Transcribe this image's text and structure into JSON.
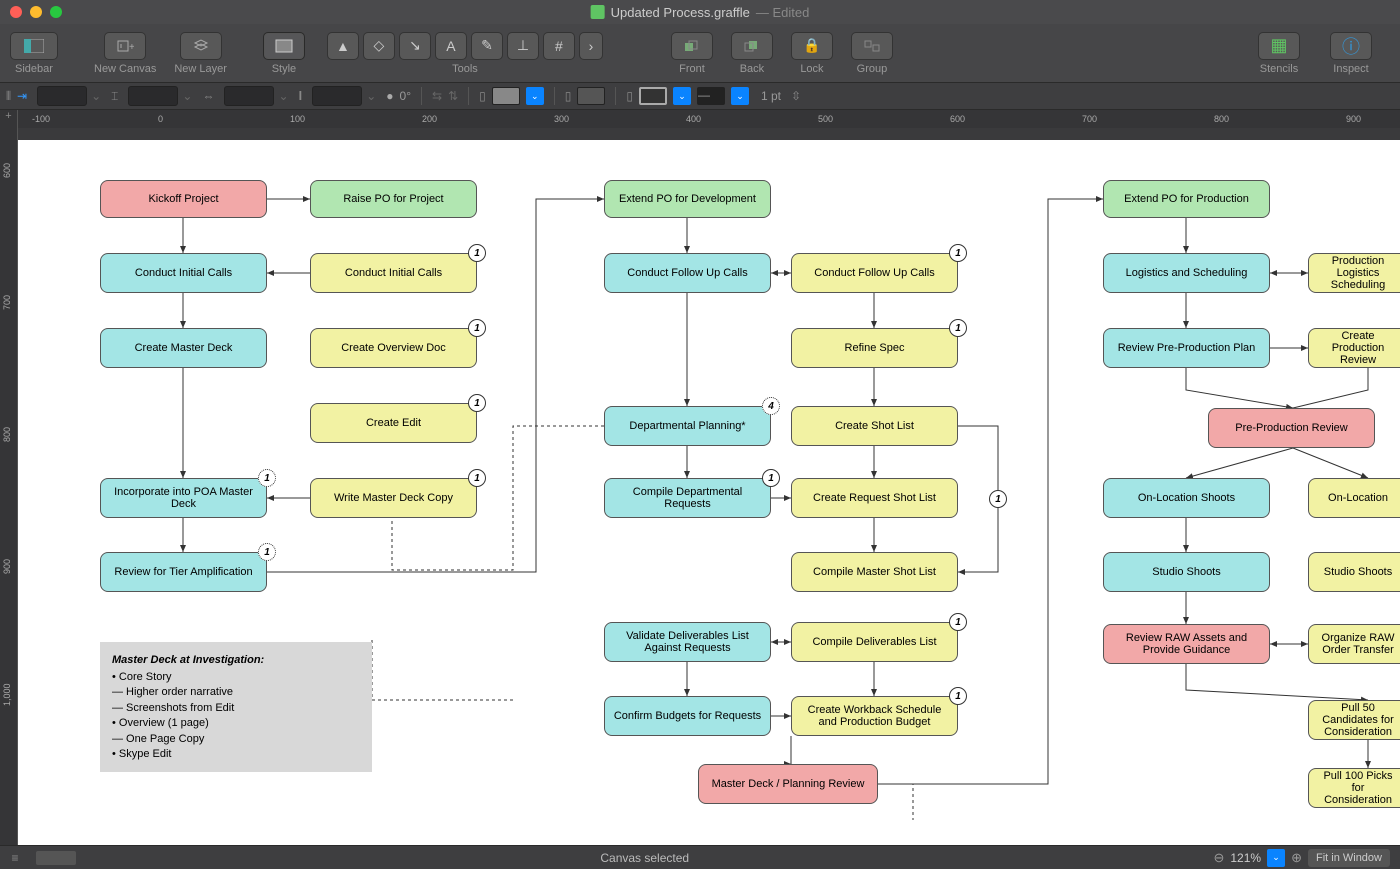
{
  "window": {
    "title": "Updated Process.graffle",
    "edited_suffix": "— Edited"
  },
  "toolbar": {
    "sidebar": "Sidebar",
    "new_canvas": "New Canvas",
    "new_layer": "New Layer",
    "style": "Style",
    "tools": "Tools",
    "front": "Front",
    "back": "Back",
    "lock": "Lock",
    "group": "Group",
    "stencils": "Stencils",
    "inspect": "Inspect"
  },
  "formatbar": {
    "rotation": "0°",
    "stroke_width": "1 pt"
  },
  "ruler": {
    "h": [
      "-100",
      "0",
      "100",
      "200",
      "300",
      "400",
      "500",
      "600",
      "700",
      "800",
      "900"
    ],
    "v": [
      "600",
      "700",
      "800",
      "900",
      "1,000"
    ]
  },
  "boxes": {
    "kickoff": "Kickoff Project",
    "raise_po": "Raise PO for Project",
    "conduct_calls_cyan": "Conduct Initial Calls",
    "conduct_calls_yellow": "Conduct Initial Calls",
    "create_master_deck": "Create Master Deck",
    "create_overview": "Create Overview Doc",
    "create_edit": "Create Edit",
    "incorporate": "Incorporate into POA Master Deck",
    "write_master_copy": "Write Master Deck Copy",
    "review_tier": "Review for Tier Amplification",
    "extend_po_dev": "Extend PO for Development",
    "conduct_follow_cyan": "Conduct Follow Up Calls",
    "conduct_follow_yellow": "Conduct Follow Up Calls",
    "refine_spec": "Refine Spec",
    "dept_planning": "Departmental Planning*",
    "create_shot_list": "Create Shot List",
    "compile_dept_req": "Compile Departmental Requests",
    "create_req_shot": "Create Request Shot List",
    "compile_master_shot": "Compile Master Shot List",
    "validate_deliv": "Validate Deliverables List Against Requests",
    "compile_deliv": "Compile Deliverables List",
    "confirm_budgets": "Confirm Budgets for Requests",
    "create_workback": "Create Workback Schedule and Production Budget",
    "master_planning_review": "Master Deck / Planning Review",
    "extend_po_prod": "Extend PO for Production",
    "logistics": "Logistics and Scheduling",
    "prod_log_sched": "Production Logistics Scheduling",
    "review_preprod": "Review Pre-Production Plan",
    "create_prod_review": "Create Production Review",
    "preprod_review": "Pre-Production Review",
    "onloc_shoots_cyan": "On-Location Shoots",
    "onloc_shoots_yellow": "On-Location",
    "studio_shoots_cyan": "Studio Shoots",
    "studio_shoots_yellow": "Studio Shoots",
    "review_raw": "Review RAW Assets and Provide Guidance",
    "organize_raw": "Organize RAW Order Transfer",
    "pull_50": "Pull 50 Candidates for Consideration",
    "pull_100": "Pull 100 Picks for Consideration"
  },
  "badges": {
    "b1": "1",
    "b4": "4"
  },
  "note": {
    "title": "Master Deck at Investigation:",
    "lines": [
      "• Core Story",
      "— Higher order narrative",
      "— Screenshots from Edit",
      "• Overview (1 page)",
      "— One Page Copy",
      "• Skype Edit"
    ]
  },
  "statusbar": {
    "center": "Canvas selected",
    "zoom": "121%",
    "fit": "Fit in Window"
  }
}
